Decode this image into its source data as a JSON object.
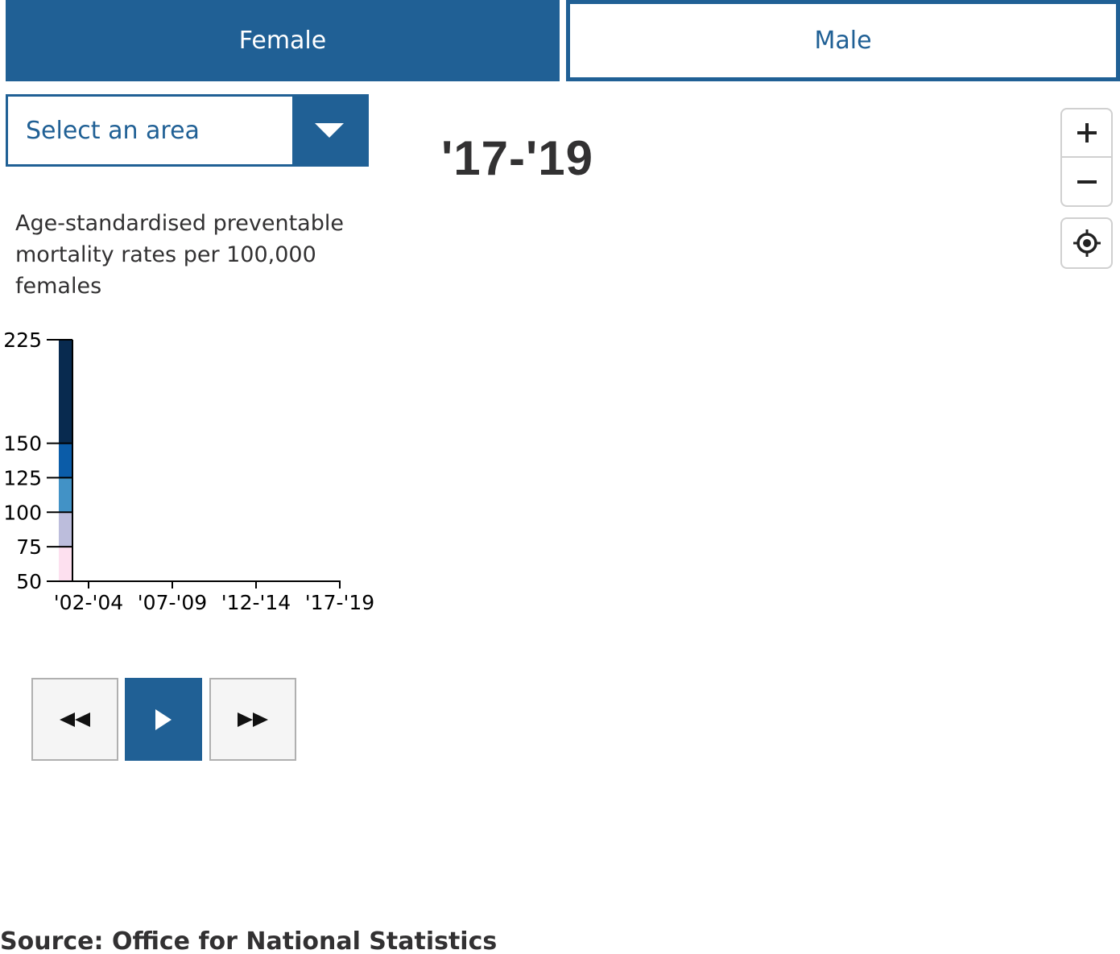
{
  "toggle": {
    "female_label": "Female",
    "male_label": "Male",
    "selected": "Female"
  },
  "area_select": {
    "placeholder": "Select an area"
  },
  "period": {
    "current": "'17-'19"
  },
  "map_controls": {
    "zoom_in": "zoom-in",
    "zoom_out": "zoom-out",
    "locate": "locate"
  },
  "legend": {
    "description": "Age-standardised preventable mortality rates per 100,000 females"
  },
  "chart_data": {
    "type": "bar",
    "y_ticks": [
      50,
      75,
      100,
      125,
      150,
      225
    ],
    "ylim": [
      50,
      225
    ],
    "x_ticks": [
      "'02-'04",
      "'07-'09",
      "'12-'14",
      "'17-'19"
    ],
    "color_breaks": [
      {
        "from": 50,
        "to": 75,
        "color": "#fde0ef"
      },
      {
        "from": 75,
        "to": 100,
        "color": "#bcbddc"
      },
      {
        "from": 100,
        "to": 125,
        "color": "#4292c6"
      },
      {
        "from": 125,
        "to": 150,
        "color": "#0b5ca8"
      },
      {
        "from": 150,
        "to": 225,
        "color": "#082a4f"
      }
    ]
  },
  "playback": {
    "back": "rewind",
    "play": "play",
    "forward": "fast-forward"
  },
  "source": {
    "text": "Source: Office for National Statistics"
  },
  "colors": {
    "accent": "#206095",
    "text": "#323132"
  }
}
